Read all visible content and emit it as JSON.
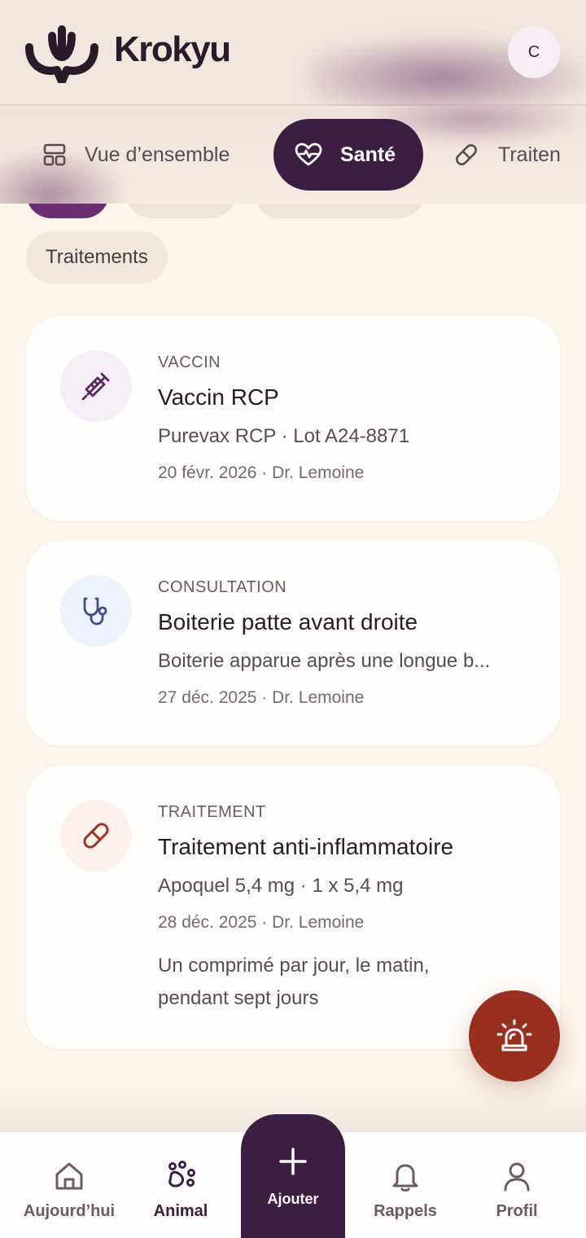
{
  "app": {
    "name": "Krokyu",
    "avatar_initial": "C"
  },
  "tabs": [
    {
      "label": "Vue d’ensemble",
      "icon": "layout-icon",
      "active": false
    },
    {
      "label": "Santé",
      "icon": "heart-pulse-icon",
      "active": true
    },
    {
      "label": "Traiten",
      "icon": "pill-icon",
      "active": false
    }
  ],
  "filters": {
    "chip_label": "Traitements"
  },
  "records": [
    {
      "kind": "VACCIN",
      "title": "Vaccin RCP",
      "subtitle": "Purevax RCP · Lot A24-8871",
      "meta": "20 févr. 2026 · Dr. Lemoine",
      "icon": "syringe-icon",
      "icon_bg": "#f6eef7",
      "icon_color": "#5a2a5e"
    },
    {
      "kind": "CONSULTATION",
      "title": "Boiterie patte avant droite",
      "subtitle": "Boiterie apparue après une longue b...",
      "meta": "27 déc. 2025 · Dr. Lemoine",
      "icon": "stethoscope-icon",
      "icon_bg": "#eef2fd",
      "icon_color": "#3d4e8f"
    },
    {
      "kind": "TRAITEMENT",
      "title": "Traitement anti-inflammatoire",
      "subtitle": "Apoquel 5,4 mg · 1 x 5,4 mg",
      "meta": "28 déc. 2025 · Dr. Lemoine",
      "note": "Un comprimé par jour, le matin, pendant sept jours",
      "icon": "pill-icon",
      "icon_bg": "#fdf1ee",
      "icon_color": "#a2351f"
    }
  ],
  "emergency": {
    "icon": "siren-icon",
    "color": "#9b2f1f"
  },
  "nav": {
    "today": "Aujourd’hui",
    "pet": "Animal",
    "add": "Ajouter",
    "reminders": "Rappels",
    "profile": "Profil",
    "active": "pet"
  },
  "colors": {
    "primary": "#3c1e42",
    "background": "#fbf5ea",
    "accent_red": "#9b2f1f"
  }
}
